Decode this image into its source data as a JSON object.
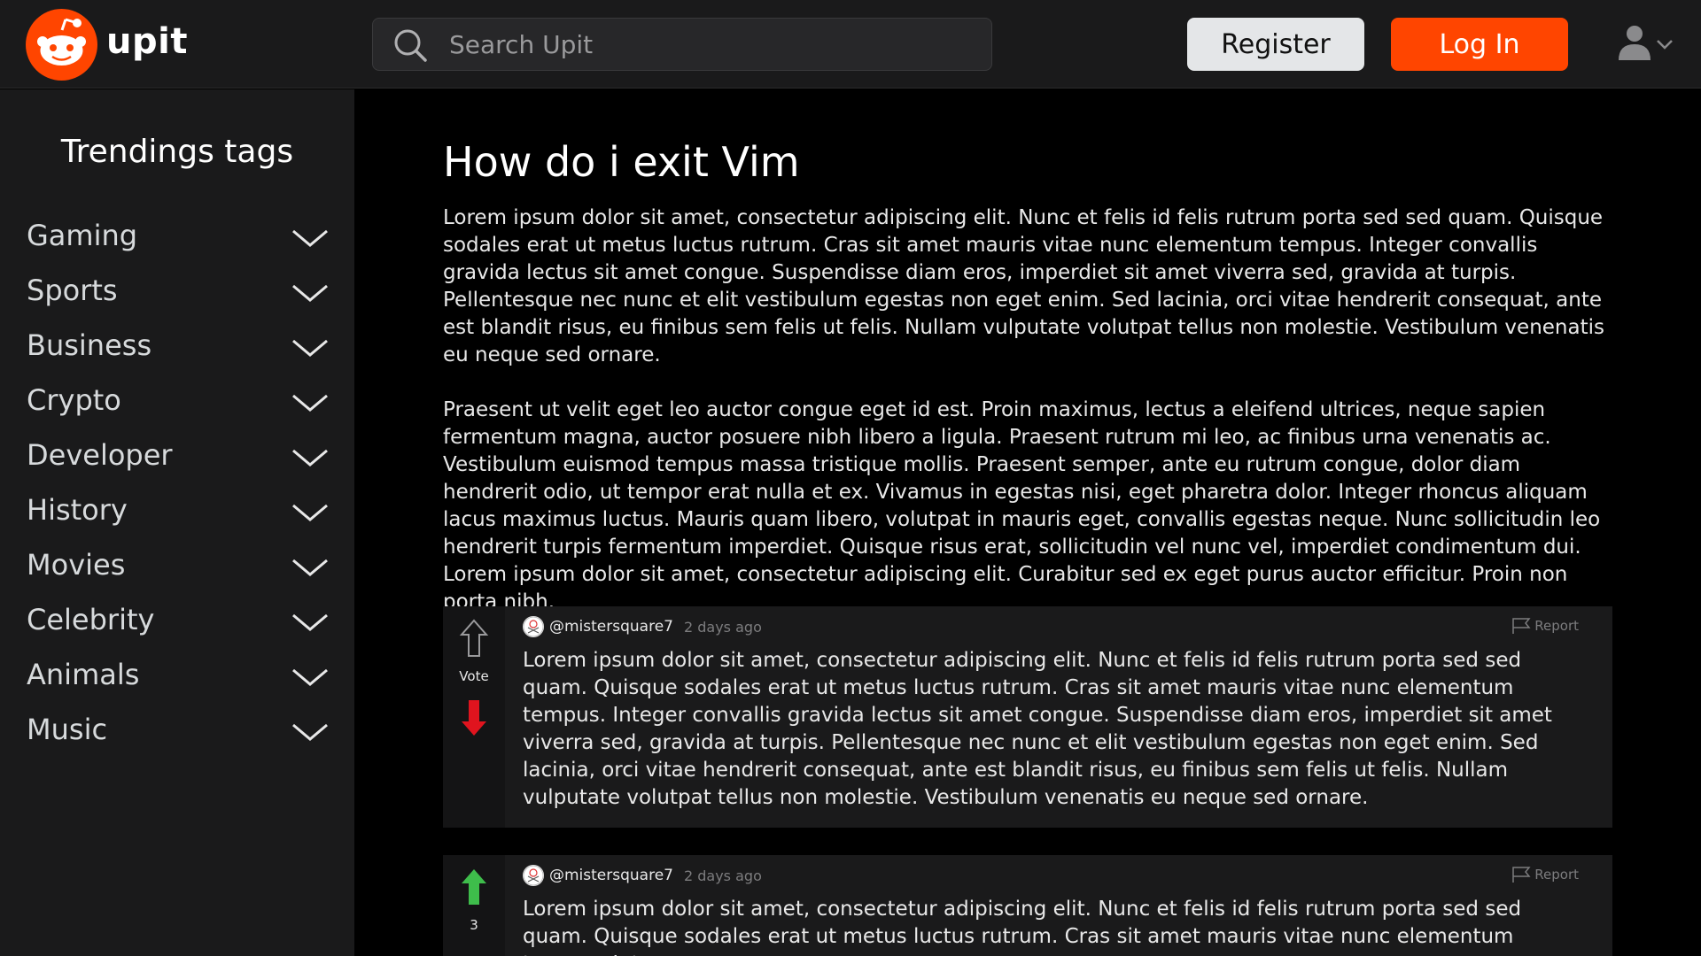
{
  "header": {
    "brand": "upit",
    "search_placeholder": "Search Upit",
    "register_label": "Register",
    "login_label": "Log In",
    "accent_color": "#ff4500"
  },
  "sidebar": {
    "title": "Trendings tags",
    "items": [
      {
        "label": "Gaming"
      },
      {
        "label": "Sports"
      },
      {
        "label": "Business"
      },
      {
        "label": "Crypto"
      },
      {
        "label": "Developer"
      },
      {
        "label": "History"
      },
      {
        "label": "Movies"
      },
      {
        "label": "Celebrity"
      },
      {
        "label": "Animals"
      },
      {
        "label": "Music"
      }
    ]
  },
  "post": {
    "title": "How do i exit Vim",
    "paragraphs": [
      "Lorem ipsum dolor sit amet, consectetur adipiscing elit. Nunc et felis id felis rutrum porta sed sed quam. Quisque sodales erat ut metus luctus rutrum. Cras sit amet mauris vitae nunc elementum tempus. Integer convallis gravida lectus sit amet congue. Suspendisse diam eros, imperdiet sit amet viverra sed, gravida at turpis. Pellentesque nec nunc et elit vestibulum egestas non eget enim. Sed lacinia, orci vitae hendrerit consequat, ante est blandit risus, eu finibus sem felis ut felis. Nullam vulputate volutpat tellus non molestie. Vestibulum venenatis eu neque sed ornare.",
      "Praesent ut velit eget leo auctor congue eget id est. Proin maximus, lectus a eleifend ultrices, neque sapien fermentum magna, auctor posuere nibh libero a ligula. Praesent rutrum mi leo, ac finibus urna venenatis ac. Vestibulum euismod tempus massa tristique mollis. Praesent semper, ante eu rutrum congue, dolor diam hendrerit odio, ut tempor erat nulla et ex. Vivamus in egestas nisi, eget pharetra dolor. Integer rhoncus aliquam lacus maximus luctus. Mauris quam libero, volutpat in mauris eget, convallis egestas neque. Nunc sollicitudin leo hendrerit turpis fermentum imperdiet. Quisque risus erat, sollicitudin vel nunc vel, imperdiet condimentum dui. Lorem ipsum dolor sit amet, consectetur adipiscing elit. Curabitur sed ex eget purus auctor efficitur. Proin non porta nibh."
    ]
  },
  "comments": [
    {
      "author": "@mistersquare7",
      "time": "2 days ago",
      "report_label": "Report",
      "vote_label": "Vote",
      "vote_state": "down",
      "text": "Lorem ipsum dolor sit amet, consectetur adipiscing elit. Nunc et felis id felis rutrum porta sed sed quam. Quisque sodales erat ut metus luctus rutrum. Cras sit amet mauris vitae nunc elementum tempus. Integer convallis gravida lectus sit amet congue. Suspendisse diam eros, imperdiet sit amet viverra sed, gravida at turpis. Pellentesque nec nunc et elit vestibulum egestas non eget enim. Sed lacinia, orci vitae hendrerit consequat, ante est blandit risus, eu finibus sem felis ut felis. Nullam vulputate volutpat tellus non molestie. Vestibulum venenatis eu neque sed ornare."
    },
    {
      "author": "@mistersquare7",
      "time": "2 days ago",
      "report_label": "Report",
      "vote_label": "3",
      "vote_state": "up",
      "text": "Lorem ipsum dolor sit amet, consectetur adipiscing elit. Nunc et felis id felis rutrum porta sed sed quam. Quisque sodales erat ut metus luctus rutrum. Cras sit amet mauris vitae nunc elementum tempus. Integer"
    }
  ],
  "colors": {
    "upvote": "#3ebd4b",
    "downvote": "#e0141e"
  }
}
